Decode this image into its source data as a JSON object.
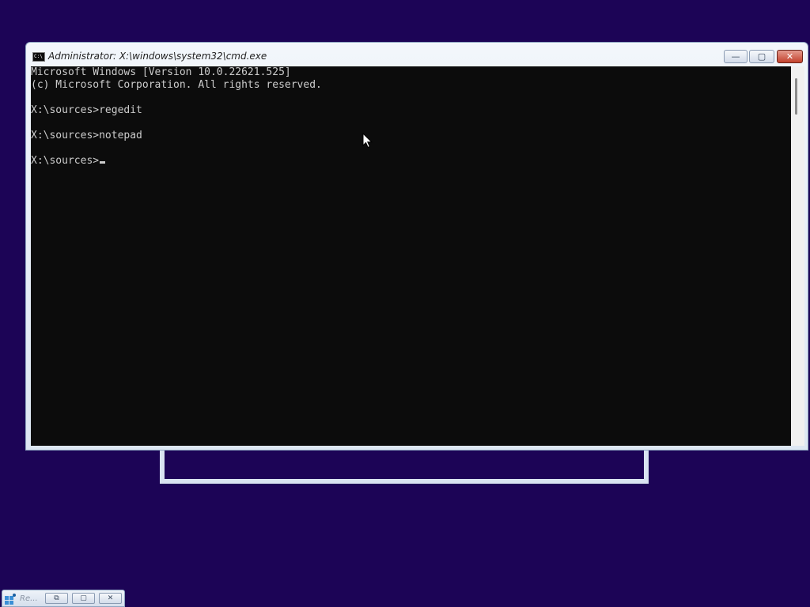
{
  "window": {
    "title": "Administrator: X:\\windows\\system32\\cmd.exe",
    "icon_label": "C:\\",
    "controls": {
      "minimize": "—",
      "maximize": "▢",
      "close": "✕"
    }
  },
  "console": {
    "lines": [
      "Microsoft Windows [Version 10.0.22621.525]",
      "(c) Microsoft Corporation. All rights reserved.",
      "",
      "X:\\sources>regedit",
      "",
      "X:\\sources>notepad",
      ""
    ],
    "prompt": "X:\\sources>"
  },
  "taskbar": {
    "label": "Re...",
    "buttons": {
      "restore": "⧉",
      "maximize": "▢",
      "close": "✕"
    }
  },
  "colors": {
    "desktop": "#1c0456",
    "console_bg": "#0c0c0c",
    "console_fg": "#cccccc"
  }
}
